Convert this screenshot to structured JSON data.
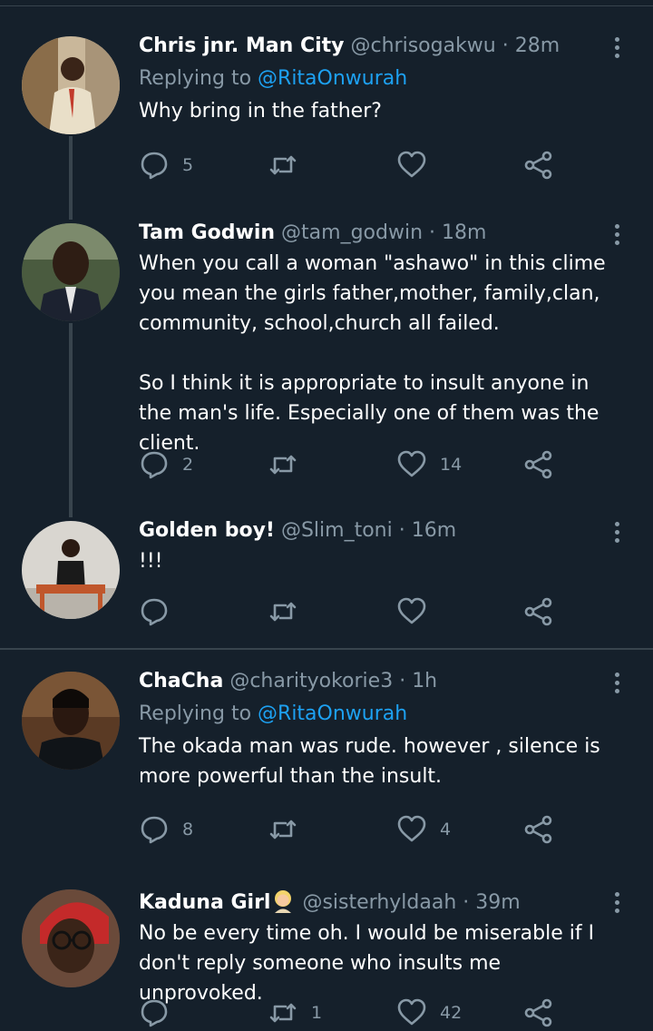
{
  "tweets": [
    {
      "name": "Chris jnr. Man City",
      "handle": "@chrisogakwu",
      "time": "· 28m",
      "reply_prefix": "Replying to ",
      "reply_mention": "@RitaOnwurah",
      "text": "Why bring in the father?",
      "replies": "5",
      "retweets": "",
      "likes": ""
    },
    {
      "name": "Tam Godwin",
      "handle": "@tam_godwin",
      "time": "· 18m",
      "text": "When you call a woman \"ashawo\" in this clime you mean the girls father,mother, family,clan, community, school,church all failed.\n\nSo I think it is appropriate to insult anyone in the man's life. Especially one of them was the client.",
      "replies": "2",
      "retweets": "",
      "likes": "14"
    },
    {
      "name": "Golden boy!",
      "handle": "@Slim_toni",
      "time": "· 16m",
      "text": "!!!",
      "replies": "",
      "retweets": "",
      "likes": ""
    },
    {
      "name": "ChaCha",
      "handle": "@charityokorie3",
      "time": "· 1h",
      "reply_prefix": "Replying to ",
      "reply_mention": "@RitaOnwurah",
      "text": "The okada man was rude. however , silence is more powerful than the insult.",
      "replies": "8",
      "retweets": "",
      "likes": "4"
    },
    {
      "name": "Kaduna Girl",
      "name_emoji": "person-with-blond-hair-emoji",
      "handle": "@sisterhyldaah",
      "time": "· 39m",
      "text": "No be every time oh. I would be miserable if I don't reply someone who insults me unprovoked.",
      "replies": "",
      "retweets": "1",
      "likes": "42"
    }
  ],
  "icons": {
    "reply": "reply-icon",
    "retweet": "retweet-icon",
    "like": "like-icon",
    "share": "share-icon",
    "more": "more-options-icon"
  },
  "colors": {
    "background": "#15202b",
    "secondary_text": "#8899a6",
    "link": "#1da1f2",
    "divider": "#38444d"
  }
}
